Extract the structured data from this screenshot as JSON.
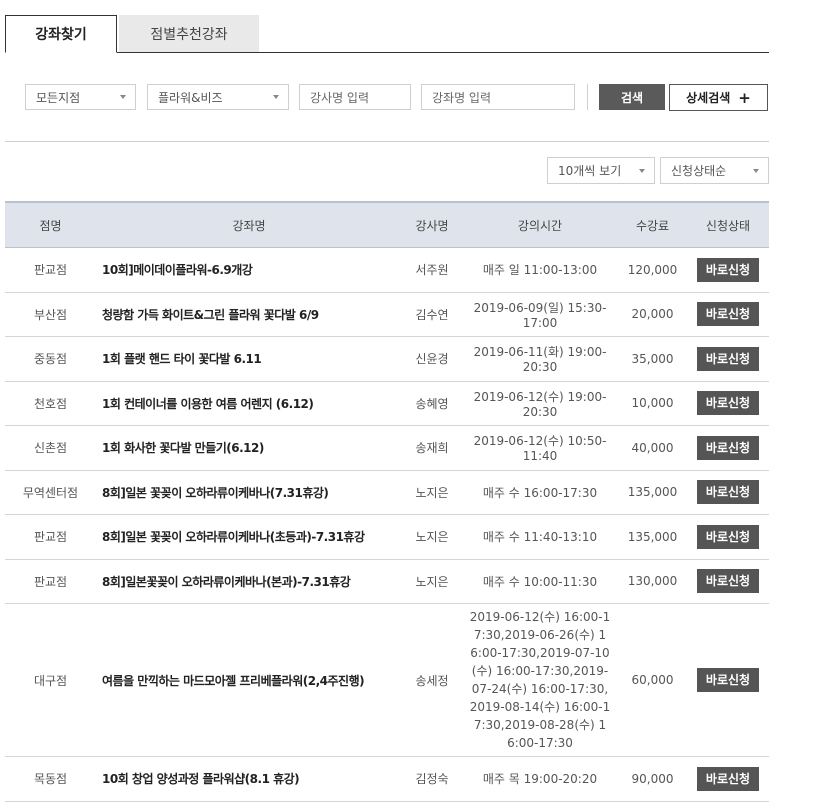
{
  "tabs": [
    {
      "label": "강좌찾기"
    },
    {
      "label": "점별추천강좌"
    }
  ],
  "search": {
    "branch_select": "모든지점",
    "category_select": "플라워&비즈",
    "instructor_placeholder": "강사명 입력",
    "course_placeholder": "강좌명 입력",
    "search_button": "검색",
    "detail_button": "상세검색",
    "detail_icon": "+"
  },
  "list_controls": {
    "per_page": "10개씩 보기",
    "sort": "신청상태순"
  },
  "table": {
    "headers": [
      "점명",
      "강좌명",
      "강사명",
      "강의시간",
      "수강료",
      "신청상태"
    ],
    "rows": [
      {
        "branch": "판교점",
        "title": "10회]메이데이플라워-6.9개강",
        "instructor": "서주원",
        "time": "매주 일 11:00-13:00",
        "fee": "120,000",
        "status": "바로신청"
      },
      {
        "branch": "부산점",
        "title": "청량함 가득 화이트&그린 플라워 꽃다발 6/9",
        "instructor": "김수연",
        "time": "2019-06-09(일) 15:30-17:00",
        "fee": "20,000",
        "status": "바로신청"
      },
      {
        "branch": "중동점",
        "title": "1회 플랫 핸드 타이 꽃다발 6.11",
        "instructor": "신윤경",
        "time": "2019-06-11(화) 19:00-20:30",
        "fee": "35,000",
        "status": "바로신청"
      },
      {
        "branch": "천호점",
        "title": "1회 컨테이너를 이용한 여름 어렌지 (6.12)",
        "instructor": "송혜영",
        "time": "2019-06-12(수) 19:00-20:30",
        "fee": "10,000",
        "status": "바로신청"
      },
      {
        "branch": "신촌점",
        "title": "1회 화사한 꽃다발 만들기(6.12)",
        "instructor": "송재희",
        "time": "2019-06-12(수) 10:50-11:40",
        "fee": "40,000",
        "status": "바로신청"
      },
      {
        "branch": "무역센터점",
        "title": "8회]일본 꽃꽂이 오하라류이케바나(7.31휴강)",
        "instructor": "노지은",
        "time": "매주 수 16:00-17:30",
        "fee": "135,000",
        "status": "바로신청"
      },
      {
        "branch": "판교점",
        "title": "8회]일본 꽃꽂이 오하라류이케바나(초등과)-7.31휴강",
        "instructor": "노지은",
        "time": "매주 수 11:40-13:10",
        "fee": "135,000",
        "status": "바로신청"
      },
      {
        "branch": "판교점",
        "title": "8회]일본꽃꽂이 오하라류이케바나(본과)-7.31휴강",
        "instructor": "노지은",
        "time": "매주 수 10:00-11:30",
        "fee": "130,000",
        "status": "바로신청"
      },
      {
        "branch": "대구점",
        "title": "여름을 만끽하는 마드모아젤 프리베플라워(2,4주진행)",
        "instructor": "송세정",
        "time": "2019-06-12(수) 16:00-17:30,2019-06-26(수) 16:00-17:30,2019-07-10(수) 16:00-17:30,2019-07-24(수) 16:00-17:30,2019-08-14(수) 16:00-17:30,2019-08-28(수) 16:00-17:30",
        "fee": "60,000",
        "status": "바로신청"
      },
      {
        "branch": "목동점",
        "title": "10회 창업 양성과정 플라워샵(8.1 휴강)",
        "instructor": "김정숙",
        "time": "매주 목 19:00-20:20",
        "fee": "90,000",
        "status": "바로신청"
      }
    ]
  }
}
